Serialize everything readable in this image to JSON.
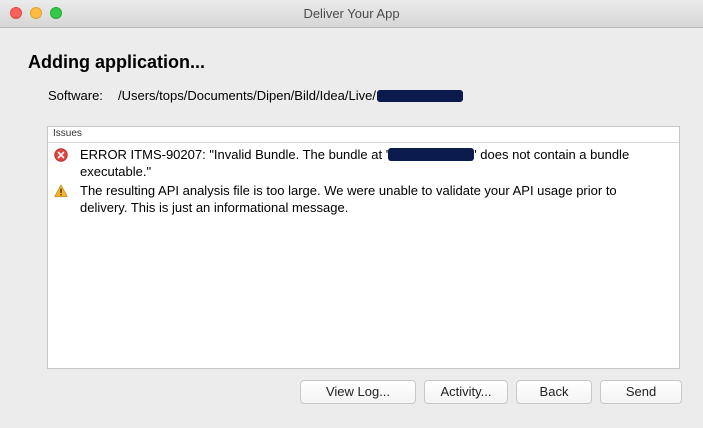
{
  "window": {
    "title": "Deliver Your App"
  },
  "heading": "Adding application...",
  "software": {
    "label": "Software:",
    "path": "/Users/tops/Documents/Dipen/Bild/Idea/Live/"
  },
  "issues": {
    "header": "Issues",
    "items": [
      {
        "type": "error",
        "icon": "error-icon",
        "text_before": "ERROR ITMS-90207: \"Invalid Bundle. The bundle at '",
        "text_after": "' does not contain a bundle executable.\""
      },
      {
        "type": "warning",
        "icon": "warning-icon",
        "text": "The resulting API analysis file is too large.  We were unable to validate your API usage prior to delivery.  This is just an informational message."
      }
    ]
  },
  "buttons": {
    "view_log": "View Log...",
    "activity": "Activity...",
    "back": "Back",
    "send": "Send"
  },
  "colors": {
    "error": "#e0443e",
    "warning": "#f2b632",
    "redaction": "#0b1b4d"
  }
}
